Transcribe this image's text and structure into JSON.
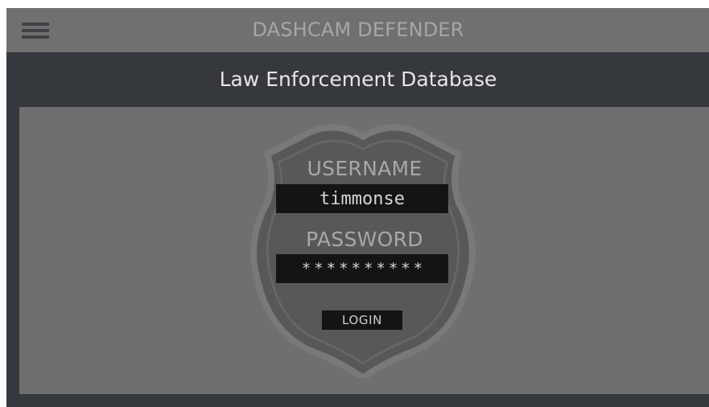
{
  "app": {
    "title": "DASHCAM DEFENDER",
    "menu_icon": "hamburger-menu-icon"
  },
  "page": {
    "subtitle": "Law Enforcement Database"
  },
  "login_form": {
    "badge_icon": "police-badge-icon",
    "username_label": "USERNAME",
    "username_value": "timmonse",
    "password_label": "PASSWORD",
    "password_value": "**********",
    "login_label": "LOGIN"
  },
  "colors": {
    "top_bar": "#707070",
    "app_background": "#35383c",
    "content_background": "#6f6f6f",
    "badge_fill": "#585858",
    "badge_outline": "#797979",
    "field_background": "#141414",
    "label_text": "#a8a8a8"
  }
}
